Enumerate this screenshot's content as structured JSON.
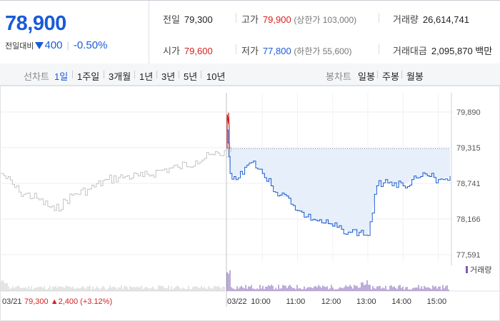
{
  "quote": {
    "current_price": "78,900",
    "change_label": "전일대비",
    "change_amount": "400",
    "change_rate": "-0.50%",
    "prev_close": {
      "label": "전일",
      "value": "79,300"
    },
    "high": {
      "label": "고가",
      "value": "79,900",
      "note": "(상한가 103,000)"
    },
    "volume": {
      "label": "거래량",
      "value": "26,614,741"
    },
    "open": {
      "label": "시가",
      "value": "79,600"
    },
    "low": {
      "label": "저가",
      "value": "77,800",
      "note": "(하한가 55,600)"
    },
    "trade_value": {
      "label": "거래대금",
      "value": "2,095,870 백만"
    }
  },
  "toolbar": {
    "line_chart_label": "선차트",
    "periods": [
      "1일",
      "1주일",
      "3개월",
      "1년",
      "3년",
      "5년",
      "10년"
    ],
    "selected_period": "1일",
    "candle_chart_label": "봉차트",
    "candle_periods": [
      "일봉",
      "주봉",
      "월봉"
    ]
  },
  "colors": {
    "up": "#d61f1f",
    "down": "#1a5bd6",
    "prev_day": "#c4c4c4",
    "fill": "#e7effa",
    "volume_today": "#7d5bb0",
    "volume_prev": "#c9c9c9"
  },
  "chart_data": {
    "type": "line",
    "ylim": [
      77591,
      79890
    ],
    "yticks": [
      "79,890",
      "79,315",
      "78,741",
      "78,166",
      "77,591"
    ],
    "yticks_values": [
      79890,
      79315,
      78741,
      78166,
      77591
    ],
    "reference_line": 79300,
    "xlabels": [
      "03/21",
      "03/22",
      "10:00",
      "11:00",
      "12:00",
      "13:00",
      "14:00",
      "15:00"
    ],
    "volume_legend": "거래량",
    "prev_day_note": {
      "close": "79,300",
      "change": "2,400",
      "rate": "(+3.12%)"
    },
    "series": [
      {
        "x": [
          "03/21 09:00",
          "03/21 09:30",
          "03/21 10:00",
          "03/21 10:30",
          "03/21 11:00",
          "03/21 11:30",
          "03/21 12:00",
          "03/21 12:30",
          "03/21 13:00",
          "03/21 13:30",
          "03/21 14:00",
          "03/21 14:30",
          "03/21 15:00",
          "03/21 15:30"
        ],
        "values": [
          78900,
          78600,
          78500,
          78300,
          78550,
          78650,
          78800,
          78850,
          78850,
          78950,
          79000,
          79100,
          79200,
          79250
        ]
      },
      {
        "x": [
          "03/22 09:00",
          "03/22 09:05",
          "03/22 09:15",
          "03/22 09:30",
          "03/22 09:45",
          "03/22 10:00",
          "03/22 10:15",
          "03/22 10:30",
          "03/22 10:45",
          "03/22 11:00",
          "03/22 11:15",
          "03/22 11:30",
          "03/22 11:45",
          "03/22 12:00",
          "03/22 12:15",
          "03/22 12:30",
          "03/22 12:45",
          "03/22 13:00",
          "03/22 13:15",
          "03/22 13:30",
          "03/22 13:45",
          "03/22 14:00",
          "03/22 14:15",
          "03/22 14:30",
          "03/22 14:45",
          "03/22 15:00",
          "03/22 15:20"
        ],
        "values": [
          79600,
          78900,
          78800,
          79000,
          79100,
          78900,
          78700,
          78550,
          78500,
          78300,
          78200,
          78150,
          78100,
          78050,
          78000,
          77950,
          77950,
          77900,
          78700,
          78800,
          78750,
          78700,
          78800,
          78850,
          78850,
          78800,
          78850
        ]
      }
    ]
  }
}
